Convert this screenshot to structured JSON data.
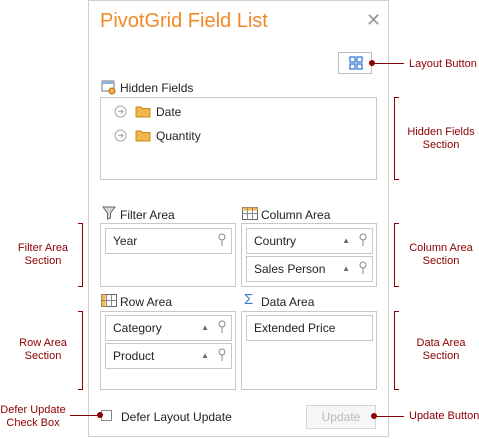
{
  "title": "PivotGrid Field List",
  "areas": {
    "hidden": {
      "label": "Hidden Fields",
      "items": [
        "Date",
        "Quantity"
      ]
    },
    "filter": {
      "label": "Filter Area",
      "items": [
        "Year"
      ]
    },
    "column": {
      "label": "Column Area",
      "items": [
        "Country",
        "Sales Person"
      ]
    },
    "row": {
      "label": "Row Area",
      "items": [
        "Category",
        "Product"
      ]
    },
    "data": {
      "label": "Data Area",
      "items": [
        "Extended Price"
      ]
    }
  },
  "defer_checkbox_label": "Defer Layout Update",
  "update_button_label": "Update",
  "callouts": {
    "layout_button": "Layout Button",
    "hidden_fields_section": "Hidden Fields\nSection",
    "filter_area_section": "Filter Area\nSection",
    "column_area_section": "Column Area\nSection",
    "row_area_section": "Row Area\nSection",
    "data_area_section": "Data Area\nSection",
    "defer_update_check_box": "Defer Update\nCheck Box",
    "update_button": "Update Button"
  },
  "colors": {
    "title": "#f08a24",
    "callout": "#8b0000",
    "folder": "#f2b84b",
    "accent_blue": "#3a7bd5"
  },
  "icons": {
    "close": "close-icon",
    "layout": "layout-grid-icon",
    "hidden": "hidden-fields-icon",
    "filter": "filter-icon",
    "column": "column-area-icon",
    "row": "row-area-icon",
    "data": "sigma-icon",
    "folder": "folder-icon",
    "pin": "pin-icon",
    "sort": "sort-ascending-icon"
  }
}
